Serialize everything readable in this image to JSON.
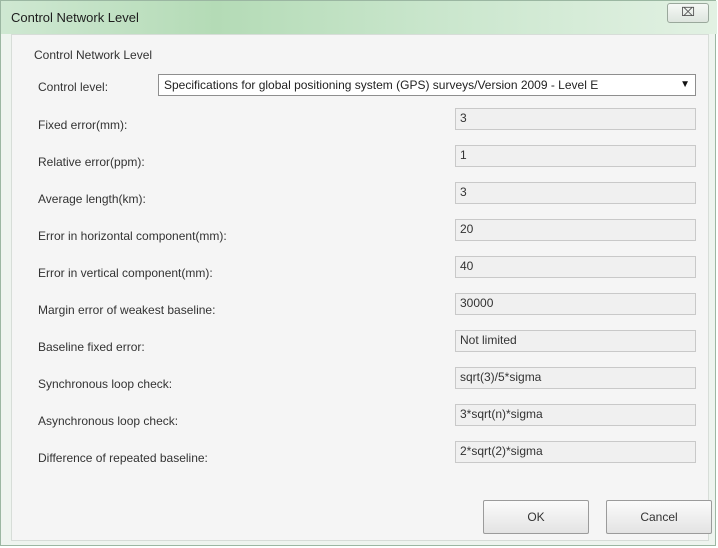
{
  "window": {
    "title": "Control Network Level",
    "close_label": "⌧"
  },
  "group": {
    "title": "Control Network Level"
  },
  "control_level": {
    "label": "Control level:",
    "selected": "Specifications for global positioning system (GPS) surveys/Version 2009 - Level E"
  },
  "fields": [
    {
      "label": "Fixed error(mm):",
      "value": "3"
    },
    {
      "label": "Relative error(ppm):",
      "value": "1"
    },
    {
      "label": "Average length(km):",
      "value": "3"
    },
    {
      "label": "Error in horizontal component(mm):",
      "value": "20"
    },
    {
      "label": "Error in vertical component(mm):",
      "value": "40"
    },
    {
      "label": "Margin error of weakest baseline:",
      "value": "30000"
    },
    {
      "label": "Baseline fixed error:",
      "value": "Not limited"
    },
    {
      "label": "Synchronous loop check:",
      "value": "sqrt(3)/5*sigma"
    },
    {
      "label": "Asynchronous loop check:",
      "value": "3*sqrt(n)*sigma"
    },
    {
      "label": "Difference of repeated baseline:",
      "value": "2*sqrt(2)*sigma"
    }
  ],
  "buttons": {
    "ok": "OK",
    "cancel": "Cancel"
  }
}
